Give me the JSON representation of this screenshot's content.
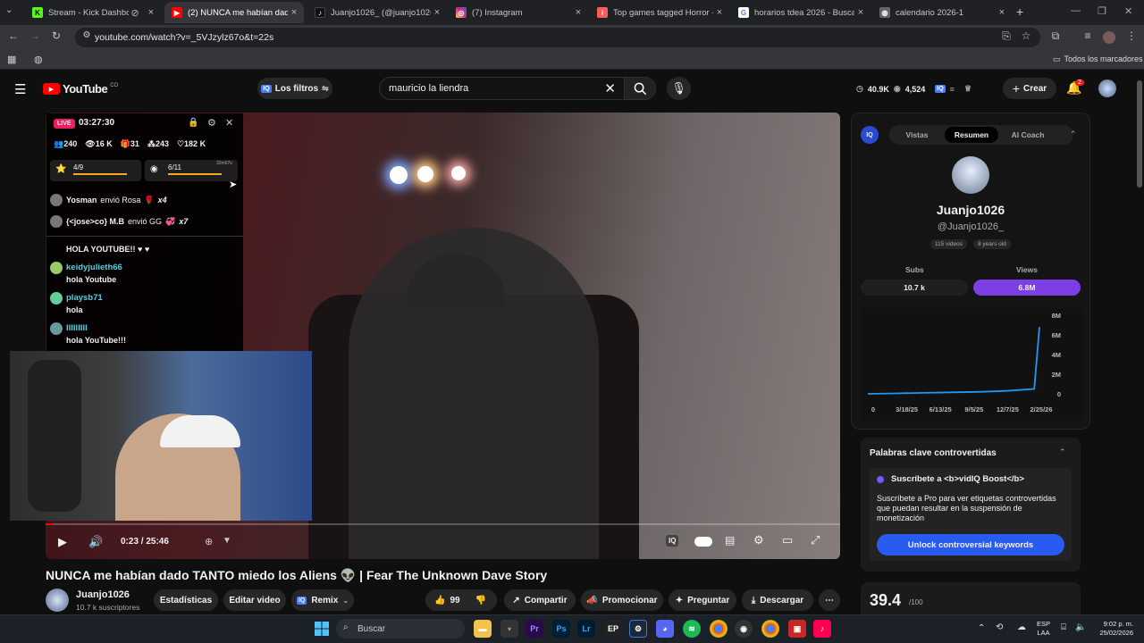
{
  "browser": {
    "tabs": [
      {
        "label": "Stream - Kick Dashboard",
        "icon": "kick-icon",
        "color": "#53fc18"
      },
      {
        "label": "(2) NUNCA me habían dado TA",
        "icon": "youtube-icon",
        "color": "#ff0000"
      },
      {
        "label": "Juanjo1026_ (@juanjo1026_) |",
        "icon": "tiktok-icon",
        "color": "#111111"
      },
      {
        "label": "(7) Instagram",
        "icon": "instagram-icon",
        "color": "#d62976"
      },
      {
        "label": "Top games tagged Horror - itc",
        "icon": "itch-icon",
        "color": "#fa5c5c"
      },
      {
        "label": "horarios tdea 2026 - Buscar co",
        "icon": "google-icon",
        "color": "#4285f4"
      },
      {
        "label": "calendario 2026-1",
        "icon": "globe-icon",
        "color": "#888888"
      }
    ],
    "url": "youtube.com/watch?v=_5VJzylz67o&t=22s",
    "bookmarks_label": "Todos los marcadores"
  },
  "youtube": {
    "logo_text": "YouTube",
    "logo_country": "CO",
    "filters_label": "Los filtros",
    "search_value": "mauricio la liendra",
    "stats": {
      "views_compact": "40.9K",
      "viewers": "4,524"
    },
    "create_label": "Crear",
    "notif_count": "2"
  },
  "stream_overlay": {
    "live_badge": "LIVE",
    "timer": "03:27:30",
    "stats": [
      {
        "icon": "people-icon",
        "value": "240"
      },
      {
        "icon": "eye-icon",
        "value": "16 K"
      },
      {
        "icon": "gift-icon",
        "value": "31"
      },
      {
        "icon": "follow-icon",
        "value": "243"
      },
      {
        "icon": "heart-icon",
        "value": "182 K"
      }
    ],
    "goal1": "4/9",
    "goal2": "6/11",
    "goal2_time": "32m57s",
    "gifts": [
      {
        "user": "Yosman",
        "action": "envió Rosa",
        "count": "x4"
      },
      {
        "user": "{<jose>co} M.B",
        "action": "envió GG",
        "count": "x7"
      }
    ],
    "pinned": "HOLA YOUTUBE!! ♥ ♥",
    "chat": [
      {
        "user": "keidyjulieth66",
        "msg": "hola Youtube"
      },
      {
        "user": "playsb71",
        "msg": "hola"
      },
      {
        "user": "IIIIIIIII",
        "msg": "hola YouTube!!!"
      }
    ]
  },
  "player": {
    "time": "0:23 / 25:46"
  },
  "video": {
    "title": "NUNCA me habían dado TANTO miedo los Aliens 👽 | Fear The Unknown Dave Story",
    "channel": "Juanjo1026",
    "subs": "10.7 k suscriptores",
    "btn_stats": "Estadísticas",
    "btn_edit": "Editar video",
    "btn_remix": "Remix",
    "likes": "99",
    "btn_share": "Compartir",
    "btn_promote": "Promocionar",
    "btn_ask": "Preguntar",
    "btn_download": "Descargar"
  },
  "vidiq": {
    "tabs": [
      "Vistas",
      "Resumen",
      "AI Coach"
    ],
    "active_tab": "Resumen",
    "channel_name": "Juanjo1026",
    "handle": "@Juanjo1026_",
    "videos": "115 videos",
    "age": "8 years old",
    "subs_label": "Subs",
    "views_label": "Views",
    "subs_value": "10.7 k",
    "views_value": "6.8M",
    "keywords_title": "Palabras clave controvertidas",
    "boost_title": "Suscríbete a <b>vidIQ Boost</b>",
    "boost_text": "Suscríbete a Pro para ver etiquetas controvertidas que puedan resultar en la suspensión de monetización",
    "unlock_label": "Unlock controversial keywords",
    "score": "39.4",
    "score_max": "/100"
  },
  "chart_data": {
    "type": "line",
    "x": [
      "0",
      "3/18/25",
      "6/13/25",
      "9/5/25",
      "12/7/25",
      "2/25/26"
    ],
    "y_ticks": [
      "8M",
      "6M",
      "4M",
      "2M",
      "0"
    ],
    "series": [
      {
        "values": [
          0.0,
          0.05,
          0.1,
          0.15,
          0.2,
          0.3,
          0.5,
          6.8
        ]
      }
    ],
    "ylim": [
      0,
      8
    ],
    "color": "#2196f3"
  },
  "taskbar": {
    "search_label": "Buscar",
    "lang1": "ESP",
    "lang2": "LAA",
    "time": "9:02 p. m.",
    "date": "25/02/2026"
  }
}
